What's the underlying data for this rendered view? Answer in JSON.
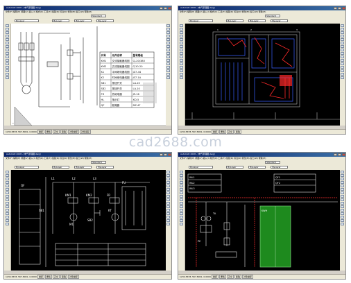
{
  "watermark": "cad2688.com",
  "window_title": "AutoCAD 2008 - [电气原理图.dwg]",
  "menu": "文件(F)  编辑(E)  视图(V)  插入(I)  格式(O)  工具(T)  绘图(D)  标注(N)  修改(M)  窗口(W)  帮助(H)",
  "layer_combo": "ByLayer",
  "font_combo": "Standard",
  "status_coords": "1234.5678, 567.8901, 0.0000",
  "status_toggles": [
    "捕捉",
    "栅格",
    "正交",
    "极轴",
    "对象捕捉",
    "对象追踪",
    "DYN",
    "线宽"
  ],
  "command_prompt": "命令:",
  "screens": [
    {
      "id": "top-left",
      "table": {
        "headers": [
          "代号",
          "元件名称",
          "型号规格"
        ],
        "rows": [
          [
            "KM1",
            "交流接触器线圈",
            "CJ-20/380"
          ],
          [
            "KM2",
            "交流接触器线圈",
            "CJ10-20"
          ],
          [
            "K1",
            "中间继电器线圈",
            "JZ7-44"
          ],
          [
            "K2",
            "时间继电器线圈",
            "JS7-1A"
          ],
          [
            "SB1",
            "按钮开关",
            "LA-10"
          ],
          [
            "SB2",
            "按钮开关",
            "LA-10"
          ],
          [
            "FR",
            "热继电器",
            "JR-16"
          ],
          [
            "HL",
            "指示灯",
            "XD-5"
          ],
          [
            "QF",
            "断路器",
            "DZ-47"
          ]
        ]
      }
    },
    {
      "id": "top-right"
    },
    {
      "id": "bottom-left",
      "labels": [
        "L1",
        "L2",
        "L3",
        "KM1",
        "KM2",
        "FR",
        "SB1",
        "SB2",
        "KT",
        "QF",
        "M1",
        "FU"
      ]
    },
    {
      "id": "bottom-right",
      "labels": [
        "WL1",
        "WL2",
        "WL3",
        "QF1",
        "QF2",
        "KWH",
        "TA",
        "PE"
      ]
    }
  ]
}
